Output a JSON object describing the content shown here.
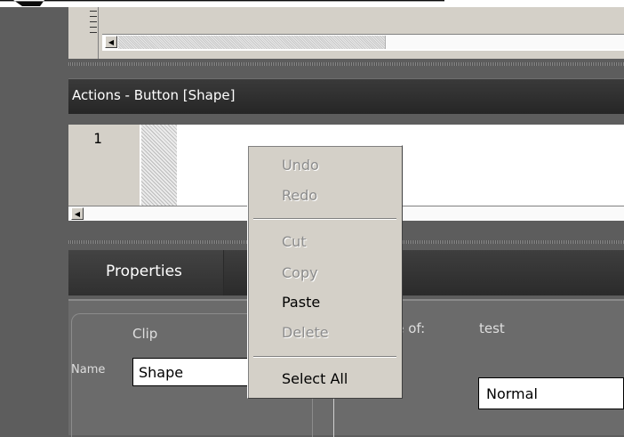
{
  "actions_panel": {
    "title": "Actions - Button [Shape]",
    "line_number": "1"
  },
  "properties": {
    "tab_label": "Properties",
    "clip_label": "Clip",
    "name_label": "Name",
    "name_value": "Shape",
    "instance_label": "ce of:",
    "instance_value": "test",
    "blend_value": "Normal"
  },
  "context_menu": {
    "undo": "Undo",
    "redo": "Redo",
    "cut": "Cut",
    "copy": "Copy",
    "paste": "Paste",
    "delete": "Delete",
    "select_all": "Select All"
  },
  "colors": {
    "panel_dark": "#2b2b2b",
    "menu_bg": "#d4d0c8",
    "disabled_text": "#8c8c8c"
  }
}
